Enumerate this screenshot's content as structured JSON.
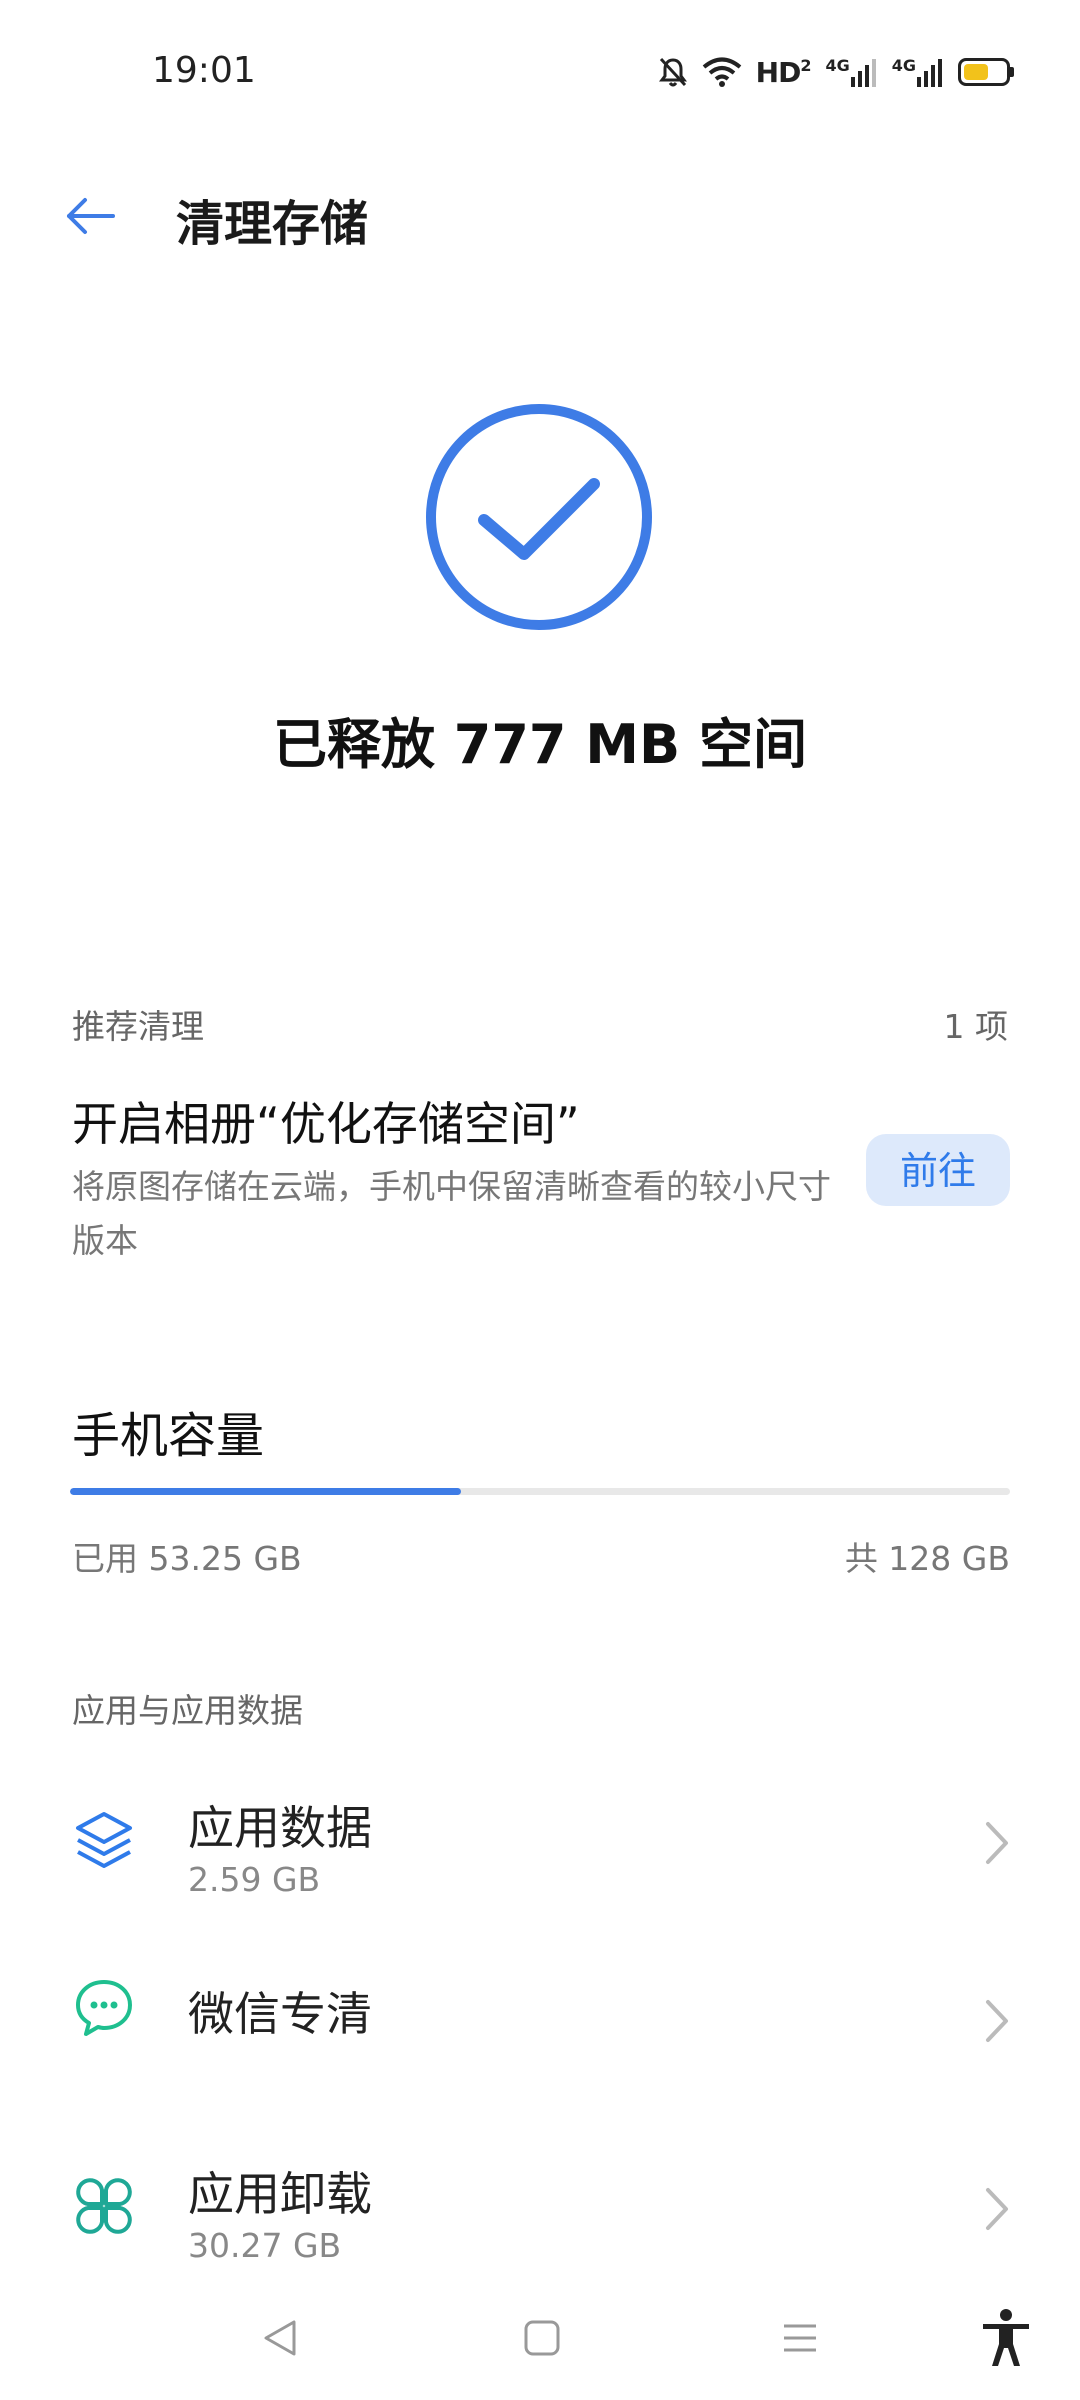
{
  "status_bar": {
    "time": "19:01",
    "hd_label": "HD",
    "hd_sub": "2",
    "net1": "4G",
    "net2": "4G",
    "battery_level": 0.6,
    "battery_color": "#f2c21b",
    "icons": [
      "bell-off-icon",
      "wifi-icon",
      "signal-icon",
      "battery-icon"
    ]
  },
  "header": {
    "title": "清理存储",
    "back_icon": "arrow-left-icon"
  },
  "result": {
    "icon": "check-circle-icon",
    "text": "已释放 777 MB 空间",
    "accent": "#3e7ce6"
  },
  "recommend": {
    "label": "推荐清理",
    "count": "1 项",
    "title": "开启相册“优化存储空间”",
    "desc": "将原图存储在云端，手机中保留清晰查看的较小尺寸版本",
    "button": "前往"
  },
  "capacity": {
    "title": "手机容量",
    "used_label": "已用 53.25 GB",
    "total_label": "共 128 GB",
    "used_fraction": 0.416
  },
  "apps_section": {
    "label": "应用与应用数据",
    "items": [
      {
        "title": "应用数据",
        "sub": "2.59 GB",
        "icon": "layers-icon"
      },
      {
        "title": "微信专清",
        "sub": "",
        "icon": "wechat-icon"
      },
      {
        "title": "应用卸载",
        "sub": "30.27 GB",
        "icon": "apps-grid-icon"
      }
    ]
  },
  "nav_bar": {
    "icons": [
      "back-triangle-icon",
      "home-square-icon",
      "recents-menu-icon",
      "accessibility-icon"
    ]
  }
}
